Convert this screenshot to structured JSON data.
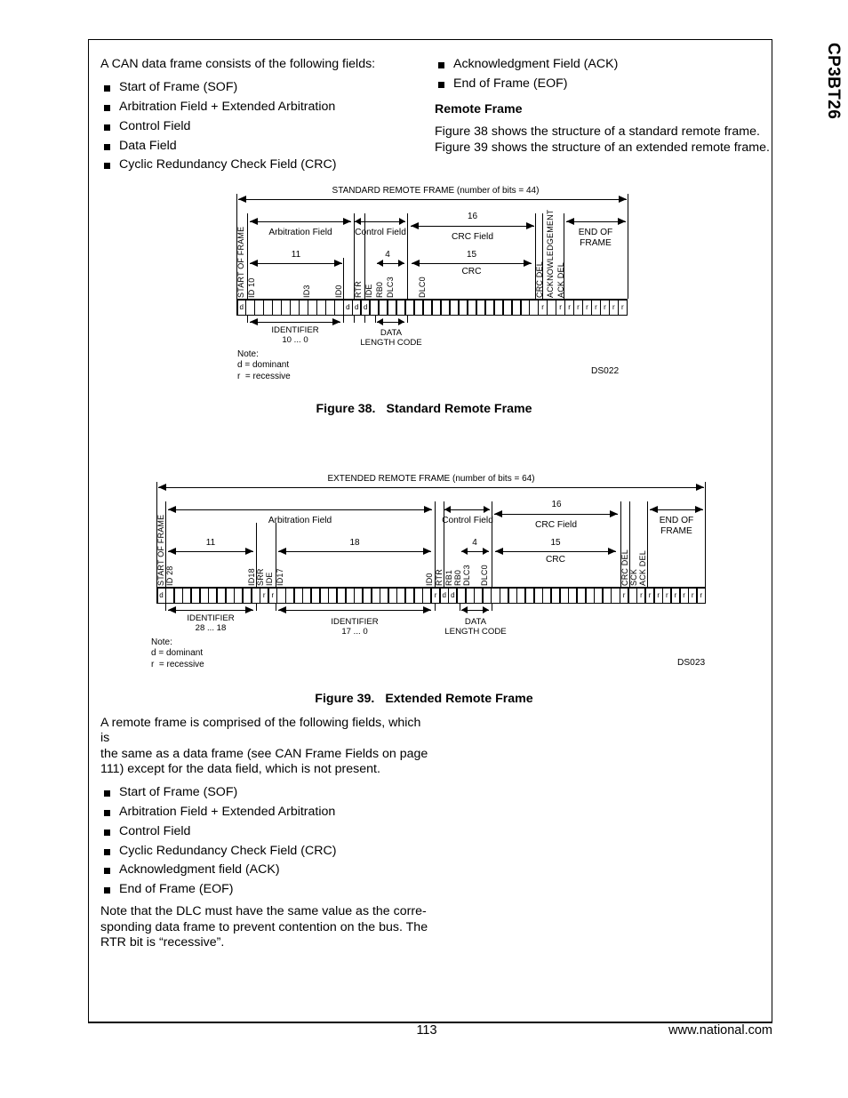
{
  "header": {
    "running_head": "CP3BT26"
  },
  "footer": {
    "page_number": "113",
    "url": "www.national.com"
  },
  "left_column": {
    "intro": "A CAN data frame consists of the following fields:",
    "fields": [
      "Start of Frame (SOF)",
      "Arbitration Field + Extended Arbitration",
      "Control Field",
      "Data Field",
      "Cyclic Redundancy Check Field (CRC)"
    ]
  },
  "right_column": {
    "fields_continued": [
      "Acknowledgment Field (ACK)",
      "End of Frame (EOF)"
    ],
    "subhead": "Remote Frame",
    "para_line1": "Figure 38 shows the structure of a standard remote frame.",
    "para_line2": "Figure 39 shows the structure of an extended remote frame."
  },
  "figure38": {
    "caption_number": "Figure 38.",
    "caption_title": "Standard Remote Frame",
    "ds_code": "DS022",
    "title": "STANDARD REMOTE FRAME (number of bits = 44)",
    "fields": {
      "sof": "START OF FRAME",
      "arbitration": "Arbitration Field",
      "control": "Control Field",
      "crc_field": "CRC Field",
      "eof_line1": "END OF",
      "eof_line2": "FRAME"
    },
    "counts": {
      "arbitration_bits": "11",
      "dlc_bits": "4",
      "crc_field_bits": "16",
      "crc_bits": "15"
    },
    "crc_label": "CRC",
    "bit_labels": {
      "id10": "ID 10",
      "id3": "ID3",
      "id0": "ID0",
      "rtr": "RTR",
      "ide": "IDE",
      "rb0": "RB0",
      "dlc3": "DLC3",
      "dlc0": "DLC0",
      "crc_del": "CRC DEL",
      "ack": "ACKNOWLEDGEMENT",
      "ack_del": "ACK DEL"
    },
    "under_labels": {
      "identifier_line1": "IDENTIFIER",
      "identifier_line2": "10 ... 0",
      "dlc_line1": "DATA",
      "dlc_line2": "LENGTH CODE"
    },
    "note": "Note:\nd = dominant\nr  = recessive",
    "bits": [
      {
        "v": "d"
      },
      {
        "v": ""
      },
      {
        "v": ""
      },
      {
        "v": ""
      },
      {
        "v": ""
      },
      {
        "v": ""
      },
      {
        "v": ""
      },
      {
        "v": ""
      },
      {
        "v": ""
      },
      {
        "v": ""
      },
      {
        "v": ""
      },
      {
        "v": ""
      },
      {
        "v": "d"
      },
      {
        "v": "d"
      },
      {
        "v": "d"
      },
      {
        "v": ""
      },
      {
        "v": ""
      },
      {
        "v": ""
      },
      {
        "v": ""
      },
      {
        "v": ""
      },
      {
        "v": ""
      },
      {
        "v": ""
      },
      {
        "v": ""
      },
      {
        "v": ""
      },
      {
        "v": ""
      },
      {
        "v": ""
      },
      {
        "v": ""
      },
      {
        "v": ""
      },
      {
        "v": ""
      },
      {
        "v": ""
      },
      {
        "v": ""
      },
      {
        "v": ""
      },
      {
        "v": ""
      },
      {
        "v": ""
      },
      {
        "v": "r"
      },
      {
        "v": ""
      },
      {
        "v": "r"
      },
      {
        "v": "r"
      },
      {
        "v": "r"
      },
      {
        "v": "r"
      },
      {
        "v": "r"
      },
      {
        "v": "r"
      },
      {
        "v": "r"
      },
      {
        "v": "r"
      }
    ]
  },
  "figure39": {
    "caption_number": "Figure 39.",
    "caption_title": "Extended Remote Frame",
    "ds_code": "DS023",
    "title": "EXTENDED REMOTE FRAME (number of bits = 64)",
    "fields": {
      "sof": "START OF FRAME",
      "arbitration": "Arbitration Field",
      "control": "Control Field",
      "crc_field": "CRC Field",
      "eof_line1": "END OF",
      "eof_line2": "FRAME"
    },
    "counts": {
      "id_high_bits": "11",
      "id_low_bits": "18",
      "dlc_bits": "4",
      "crc_field_bits": "16",
      "crc_bits": "15"
    },
    "crc_label": "CRC",
    "bit_labels": {
      "id28": "ID 28",
      "id18": "ID18",
      "srr": "SRR",
      "ide": "IDE",
      "id17": "ID17",
      "id0": "ID0",
      "rtr": "RTR",
      "rb1": "RB1",
      "rb0": "RB0",
      "dlc3": "DLC3",
      "dlc0": "DLC0",
      "crc_del": "CRC DEL",
      "ack": "SCK",
      "ack_del": "ACK DEL"
    },
    "under_labels": {
      "identifier_hi_line1": "IDENTIFIER",
      "identifier_hi_line2": "28 ... 18",
      "identifier_lo_line1": "IDENTIFIER",
      "identifier_lo_line2": "17 ... 0",
      "dlc_line1": "DATA",
      "dlc_line2": "LENGTH CODE"
    },
    "note": "Note:\nd = dominant\nr  = recessive",
    "bits": [
      {
        "v": "d"
      },
      {
        "v": ""
      },
      {
        "v": ""
      },
      {
        "v": ""
      },
      {
        "v": ""
      },
      {
        "v": ""
      },
      {
        "v": ""
      },
      {
        "v": ""
      },
      {
        "v": ""
      },
      {
        "v": ""
      },
      {
        "v": ""
      },
      {
        "v": ""
      },
      {
        "v": "r"
      },
      {
        "v": "r"
      },
      {
        "v": ""
      },
      {
        "v": ""
      },
      {
        "v": ""
      },
      {
        "v": ""
      },
      {
        "v": ""
      },
      {
        "v": ""
      },
      {
        "v": ""
      },
      {
        "v": ""
      },
      {
        "v": ""
      },
      {
        "v": ""
      },
      {
        "v": ""
      },
      {
        "v": ""
      },
      {
        "v": ""
      },
      {
        "v": ""
      },
      {
        "v": ""
      },
      {
        "v": ""
      },
      {
        "v": ""
      },
      {
        "v": ""
      },
      {
        "v": "r"
      },
      {
        "v": "d"
      },
      {
        "v": "d"
      },
      {
        "v": ""
      },
      {
        "v": ""
      },
      {
        "v": ""
      },
      {
        "v": ""
      },
      {
        "v": ""
      },
      {
        "v": ""
      },
      {
        "v": ""
      },
      {
        "v": ""
      },
      {
        "v": ""
      },
      {
        "v": ""
      },
      {
        "v": ""
      },
      {
        "v": ""
      },
      {
        "v": ""
      },
      {
        "v": ""
      },
      {
        "v": ""
      },
      {
        "v": ""
      },
      {
        "v": ""
      },
      {
        "v": ""
      },
      {
        "v": ""
      },
      {
        "v": "r"
      },
      {
        "v": ""
      },
      {
        "v": "r"
      },
      {
        "v": "r"
      },
      {
        "v": "r"
      },
      {
        "v": "r"
      },
      {
        "v": "r"
      },
      {
        "v": "r"
      },
      {
        "v": "r"
      },
      {
        "v": "r"
      }
    ]
  },
  "bottom_text": {
    "para1_line1": "A remote frame is comprised of the following fields, which is",
    "para1_line2": "the same as a data frame (see CAN Frame Fields on page",
    "para1_line3": "111) except for the data field, which is not present.",
    "fields": [
      "Start of Frame (SOF)",
      "Arbitration Field + Extended Arbitration",
      "Control Field",
      "Cyclic Redundancy Check Field (CRC)",
      "Acknowledgment field (ACK)",
      "End of Frame (EOF)"
    ],
    "para2_line1": "Note that the DLC must have the same value as the corre-",
    "para2_line2": "sponding data frame to prevent contention on the bus. The",
    "para2_line3": "RTR bit is “recessive”."
  }
}
